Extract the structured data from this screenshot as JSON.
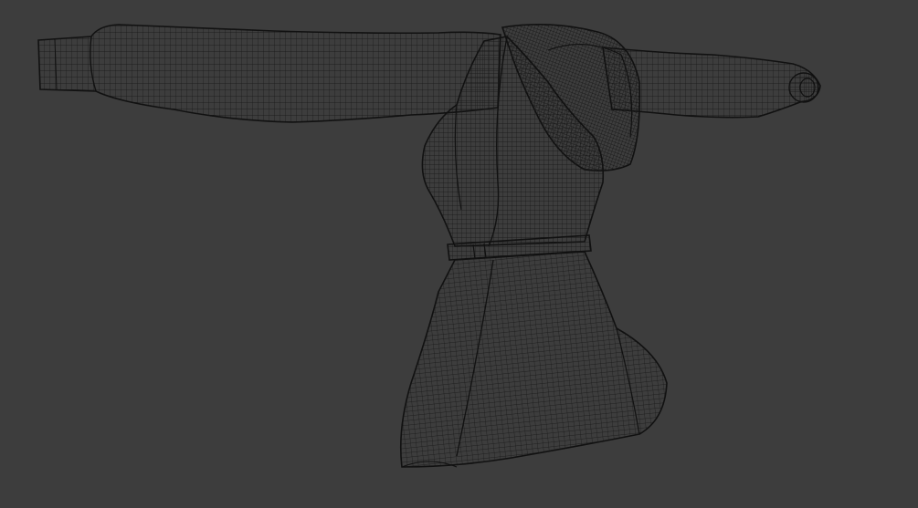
{
  "viewport": {
    "background": "#3d3d3d",
    "wire_color": "#141414",
    "object": "jacket-mesh",
    "display_mode": "wireframe"
  }
}
